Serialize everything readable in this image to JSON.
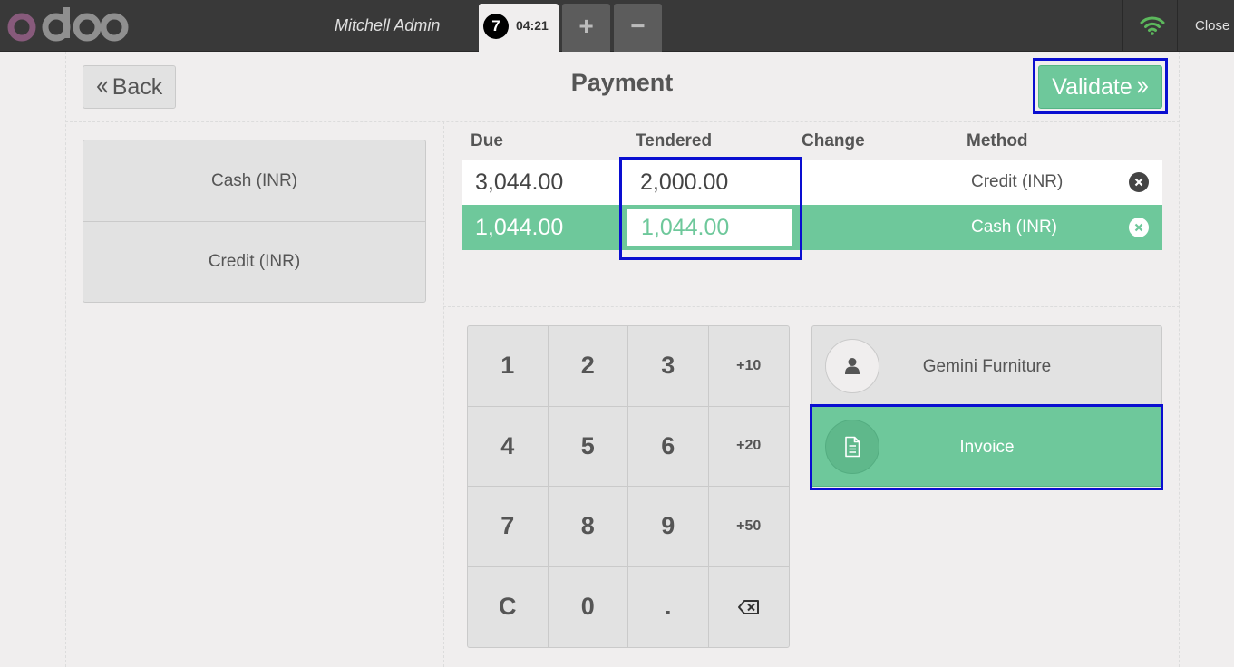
{
  "topbar": {
    "cashier": "Mitchell Admin",
    "order_tab": {
      "sequence": "7",
      "time": "04:21"
    },
    "add_order_label": "+",
    "remove_order_label": "−",
    "close_label": "Close",
    "status_icon": "wifi-icon"
  },
  "header": {
    "back_label": "Back",
    "title": "Payment",
    "validate_label": "Validate"
  },
  "payment_methods": [
    {
      "label": "Cash (INR)"
    },
    {
      "label": "Credit (INR)"
    }
  ],
  "paymentlines": {
    "columns": [
      "Due",
      "Tendered",
      "Change",
      "Method"
    ],
    "rows": [
      {
        "due": "3,044.00",
        "tendered": "2,000.00",
        "change": "",
        "method": "Credit (INR)",
        "selected": false
      },
      {
        "due": "1,044.00",
        "tendered": "1,044.00",
        "change": "",
        "method": "Cash (INR)",
        "selected": true
      }
    ]
  },
  "numpad": {
    "keys": [
      "1",
      "2",
      "3",
      "+10",
      "4",
      "5",
      "6",
      "+20",
      "7",
      "8",
      "9",
      "+50",
      "C",
      "0",
      ".",
      "⌫"
    ]
  },
  "customer": {
    "name": "Gemini Furniture",
    "icon": "user-icon"
  },
  "invoice": {
    "label": "Invoice",
    "icon": "document-icon",
    "active": true
  },
  "colors": {
    "accent": "#6ec89b",
    "topbar": "#393939",
    "background": "#f0eeee",
    "highlight": "#0a0ed0",
    "logo_o": "#875a7b",
    "logo_doo": "#8f8f8f",
    "wifi": "#5cb85c"
  }
}
